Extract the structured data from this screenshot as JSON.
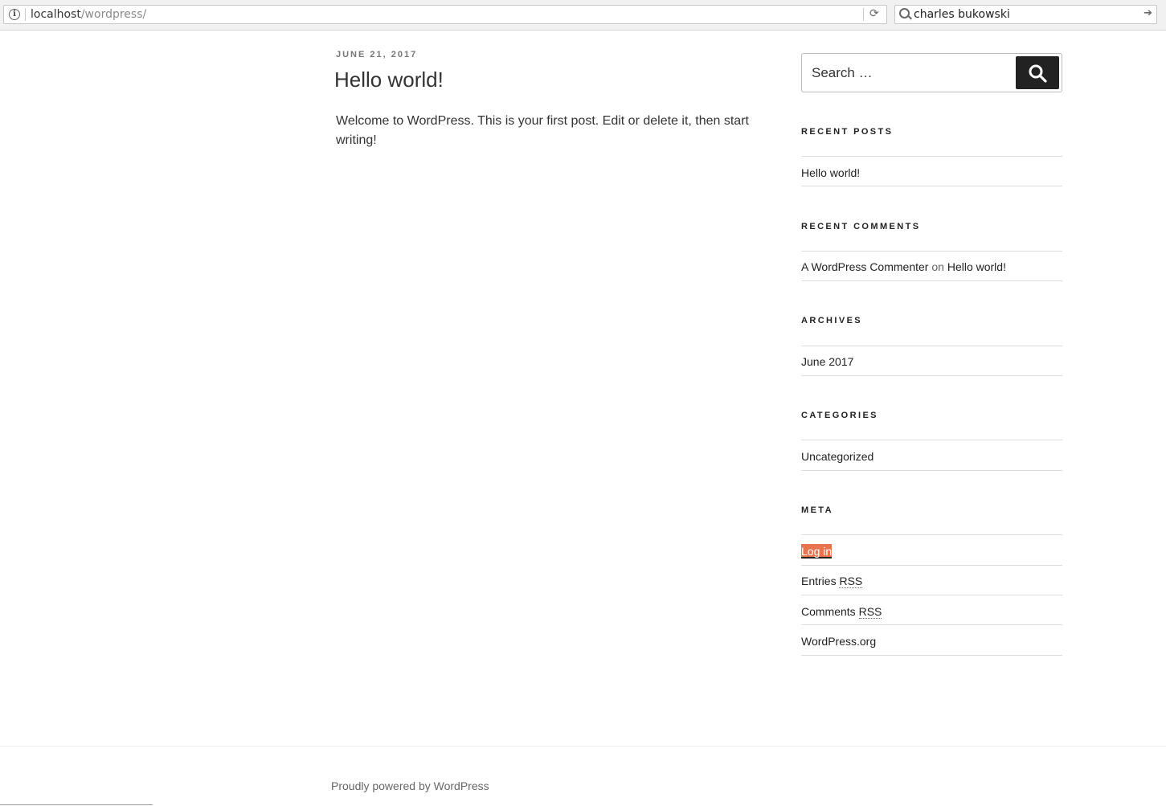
{
  "browser": {
    "url_host": "localhost",
    "url_path": "/wordpress/",
    "search_query": "charles bukowski"
  },
  "post": {
    "date": "JUNE 21, 2017",
    "title": "Hello world!",
    "body": "Welcome to WordPress. This is your first post. Edit or delete it, then start writing!"
  },
  "sidebar": {
    "search_placeholder": "Search …",
    "recent_posts": {
      "title": "RECENT POSTS",
      "items": [
        "Hello world!"
      ]
    },
    "recent_comments": {
      "title": "RECENT COMMENTS",
      "author": "A WordPress Commenter",
      "connector": "on",
      "post": "Hello world!"
    },
    "archives": {
      "title": "ARCHIVES",
      "items": [
        "June 2017"
      ]
    },
    "categories": {
      "title": "CATEGORIES",
      "items": [
        "Uncategorized"
      ]
    },
    "meta": {
      "title": "META",
      "login": "Log in",
      "entries_prefix": "Entries",
      "comments_prefix": "Comments",
      "rss": "RSS",
      "wordpress_org": "WordPress.org"
    }
  },
  "footer": {
    "text": "Proudly powered by WordPress"
  },
  "colors": {
    "highlight": "#e8734f",
    "button": "#222222"
  }
}
